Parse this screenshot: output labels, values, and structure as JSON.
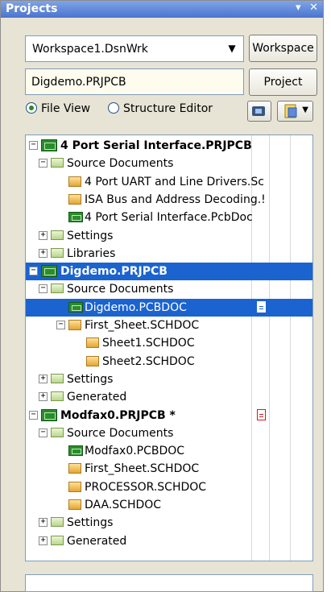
{
  "panel": {
    "title": "Projects",
    "title_icons": [
      "chevron-down-icon",
      "close-icon"
    ],
    "close_glyph": "✕"
  },
  "workspace": {
    "combo_value": "Workspace1.DsnWrk",
    "workspace_button": "Workspace",
    "project_field": "Digdemo.PRJPCB",
    "project_button": "Project"
  },
  "view": {
    "file_view": "File View",
    "structure_editor": "Structure Editor",
    "selected": "File View"
  },
  "tree": {
    "rows": [
      {
        "text": "4 Port Serial Interface.PRJPCB",
        "kind": "project",
        "level": 0,
        "expander": "minus"
      },
      {
        "text": "Source Documents",
        "kind": "folder",
        "level": 1,
        "expander": "minus"
      },
      {
        "text": "4 Port UART and Line Drivers.Sc",
        "kind": "sch",
        "level": 2
      },
      {
        "text": "ISA Bus and Address Decoding.!",
        "kind": "sch",
        "level": 2
      },
      {
        "text": "4 Port Serial Interface.PcbDoc",
        "kind": "pcb",
        "level": 2
      },
      {
        "text": "Settings",
        "kind": "folder",
        "level": 1,
        "expander": "plus"
      },
      {
        "text": "Libraries",
        "kind": "folder",
        "level": 1,
        "expander": "plus"
      },
      {
        "text": "Digdemo.PRJPCB",
        "kind": "project",
        "level": 0,
        "expander": "minus",
        "selected": true
      },
      {
        "text": "Source Documents",
        "kind": "folder",
        "level": 1,
        "expander": "minus"
      },
      {
        "text": "Digdemo.PCBDOC",
        "kind": "pcb",
        "level": 2,
        "selected": true,
        "badge": "white"
      },
      {
        "text": "First_Sheet.SCHDOC",
        "kind": "sch",
        "level": 2,
        "expander": "minus"
      },
      {
        "text": "Sheet1.SCHDOC",
        "kind": "sch",
        "level": 3
      },
      {
        "text": "Sheet2.SCHDOC",
        "kind": "sch",
        "level": 3
      },
      {
        "text": "Settings",
        "kind": "folder",
        "level": 1,
        "expander": "plus"
      },
      {
        "text": "Generated",
        "kind": "folder",
        "level": 1,
        "expander": "plus"
      },
      {
        "text": "Modfax0.PRJPCB *",
        "kind": "project",
        "level": 0,
        "expander": "minus",
        "badge": "red"
      },
      {
        "text": "Source Documents",
        "kind": "folder",
        "level": 1,
        "expander": "minus"
      },
      {
        "text": "Modfax0.PCBDOC",
        "kind": "pcb",
        "level": 2
      },
      {
        "text": "First_Sheet.SCHDOC",
        "kind": "sch",
        "level": 2
      },
      {
        "text": "PROCESSOR.SCHDOC",
        "kind": "sch",
        "level": 2
      },
      {
        "text": "DAA.SCHDOC",
        "kind": "sch",
        "level": 2
      },
      {
        "text": "Settings",
        "kind": "folder",
        "level": 1,
        "expander": "plus"
      },
      {
        "text": "Generated",
        "kind": "folder",
        "level": 1,
        "expander": "plus"
      }
    ]
  }
}
